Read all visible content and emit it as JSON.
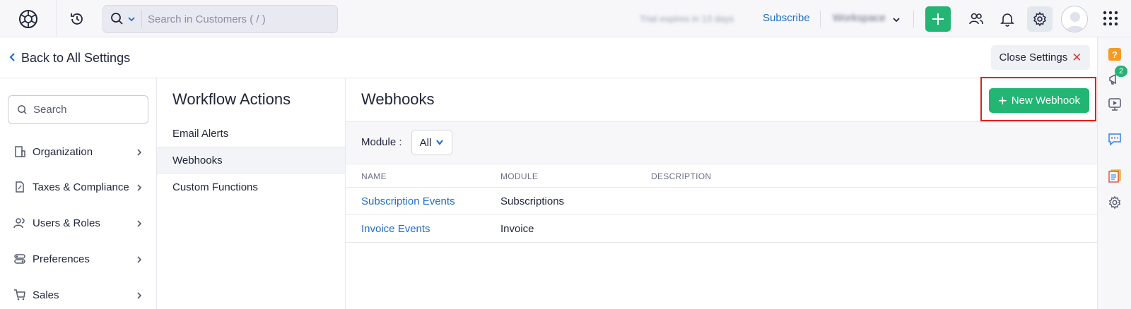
{
  "topbar": {
    "search_placeholder": "Search in Customers ( / )",
    "org_status_text": "Trial expires in 13 days",
    "subscribe_label": "Subscribe",
    "org_name": "Workspace"
  },
  "settings": {
    "back_label": "Back to All Settings",
    "close_label": "Close Settings"
  },
  "leftnav": {
    "search_placeholder": "Search",
    "items": [
      {
        "label": "Organization",
        "icon": "organization-icon"
      },
      {
        "label": "Taxes & Compliance",
        "icon": "taxes-icon"
      },
      {
        "label": "Users & Roles",
        "icon": "users-icon"
      },
      {
        "label": "Preferences",
        "icon": "preferences-icon"
      },
      {
        "label": "Sales",
        "icon": "cart-icon"
      }
    ]
  },
  "midcol": {
    "title": "Workflow Actions",
    "items": [
      {
        "label": "Email Alerts",
        "active": false
      },
      {
        "label": "Webhooks",
        "active": true
      },
      {
        "label": "Custom Functions",
        "active": false
      }
    ]
  },
  "main": {
    "title": "Webhooks",
    "new_button_label": "New Webhook",
    "filter_label": "Module :",
    "filter_value": "All",
    "columns": [
      "NAME",
      "MODULE",
      "DESCRIPTION"
    ],
    "rows": [
      {
        "name": "Subscription Events",
        "module": "Subscriptions",
        "description": ""
      },
      {
        "name": "Invoice Events",
        "module": "Invoice",
        "description": ""
      }
    ]
  },
  "rightrail": {
    "announcement_badge": "2"
  },
  "colors": {
    "accent_green": "#22b573",
    "link_blue": "#1f6fc5",
    "highlight_red": "#e02020"
  }
}
